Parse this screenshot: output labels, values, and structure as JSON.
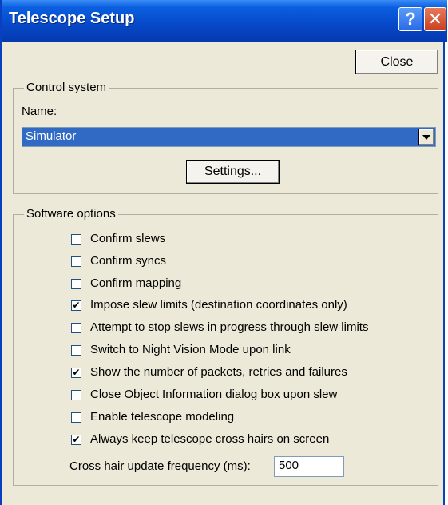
{
  "window": {
    "title": "Telescope Setup",
    "help_glyph": "?",
    "close_glyph": "✕"
  },
  "close_button": {
    "label": "Close"
  },
  "control_system": {
    "legend": "Control system",
    "name_label": "Name:",
    "selected": "Simulator",
    "settings_label": "Settings..."
  },
  "software_options": {
    "legend": "Software options",
    "options": [
      {
        "label": "Confirm slews",
        "checked": false
      },
      {
        "label": "Confirm syncs",
        "checked": false
      },
      {
        "label": "Confirm mapping",
        "checked": false
      },
      {
        "label": "Impose slew limits (destination coordinates only)",
        "checked": true
      },
      {
        "label": "Attempt to stop slews in progress through slew limits",
        "checked": false
      },
      {
        "label": "Switch to Night Vision Mode upon link",
        "checked": false
      },
      {
        "label": "Show the number of packets, retries and failures",
        "checked": true
      },
      {
        "label": "Close Object Information dialog box upon slew",
        "checked": false
      },
      {
        "label": "Enable telescope modeling",
        "checked": false
      },
      {
        "label": "Always keep telescope cross hairs on screen",
        "checked": true
      }
    ],
    "freq_label": "Cross hair update frequency (ms):",
    "freq_value": "500"
  }
}
